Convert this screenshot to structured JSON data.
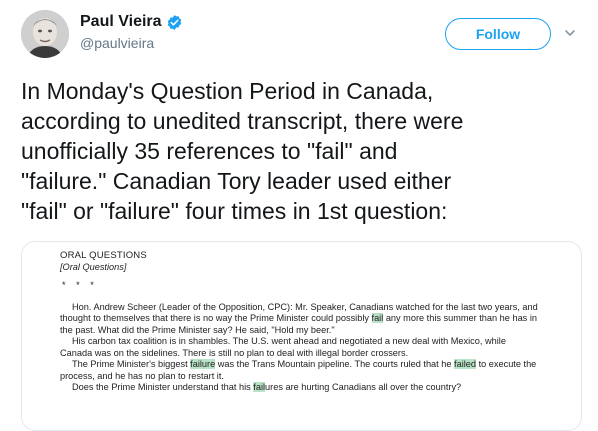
{
  "author": {
    "display_name": "Paul Vieira",
    "handle": "@paulvieira",
    "verified": true
  },
  "follow_button": {
    "label": "Follow"
  },
  "tweet": {
    "text": "In Monday's Question Period in Canada,\naccording to unedited transcript, there were\nunofficially 35 references to \"fail\" and\n\"failure.\" Canadian Tory leader used either\n\"fail\" or \"failure\" four times in 1st question:"
  },
  "media": {
    "heading": "ORAL QUESTIONS",
    "subheading": "[Oral Questions]",
    "separator": "* * *",
    "p1_a": "Hon. Andrew Scheer (Leader of the Opposition, CPC): Mr. Speaker, Canadians watched for the last two years, and thought to themselves that there is no way the Prime Minister could possibly ",
    "p1_hl": "fail",
    "p1_b": " any more this summer than he has in the past. What did the Prime Minister say? He said, \"Hold my beer.\"",
    "p2": "His carbon tax coalition is in shambles. The U.S. went ahead and negotiated a new deal with Mexico, while Canada was on the sidelines. There is still no plan to deal with illegal border crossers.",
    "p3_a": "The Prime Minister's biggest ",
    "p3_hl1": "failure",
    "p3_b": " was the Trans Mountain pipeline. The courts ruled that he ",
    "p3_hl2": "failed",
    "p3_c": " to execute the process, and he has no plan to restart it.",
    "p4_a": "Does the Prime Minister understand that his ",
    "p4_hl": "fail",
    "p4_b": "ures are hurting Canadians all over the country?"
  },
  "colors": {
    "accent": "#1da1f2",
    "secondary_text": "#657786",
    "highlight": "#b9e3c6"
  }
}
